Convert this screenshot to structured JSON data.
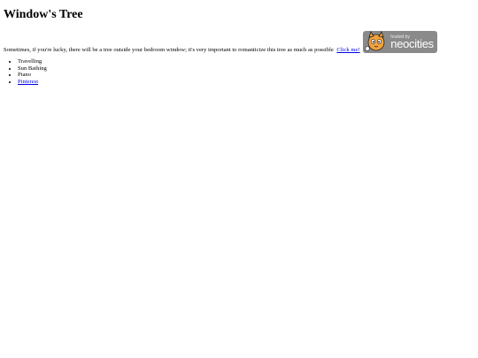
{
  "page": {
    "title": "Window's Tree"
  },
  "intro": {
    "text": "Sometimes, if you're lucky, there will be a tree outside your bedroom window; it's very important to romanticize this tree as much as possible",
    "link_label": "Click me!"
  },
  "badge": {
    "hosted_text": "hosted by",
    "brand_text": "neocities",
    "icon": "neocities-cat-icon",
    "background_color": "#8a8a8a",
    "cat_color": "#f3a23b"
  },
  "hobbies": {
    "items": [
      {
        "label": "Travelling",
        "is_link": false
      },
      {
        "label": "Sun Bathing",
        "is_link": false
      },
      {
        "label": "Piano",
        "is_link": false
      },
      {
        "label": "Pinterest",
        "is_link": true
      }
    ]
  },
  "colors": {
    "link": "#0000ee",
    "text": "#000000",
    "background": "#ffffff"
  }
}
